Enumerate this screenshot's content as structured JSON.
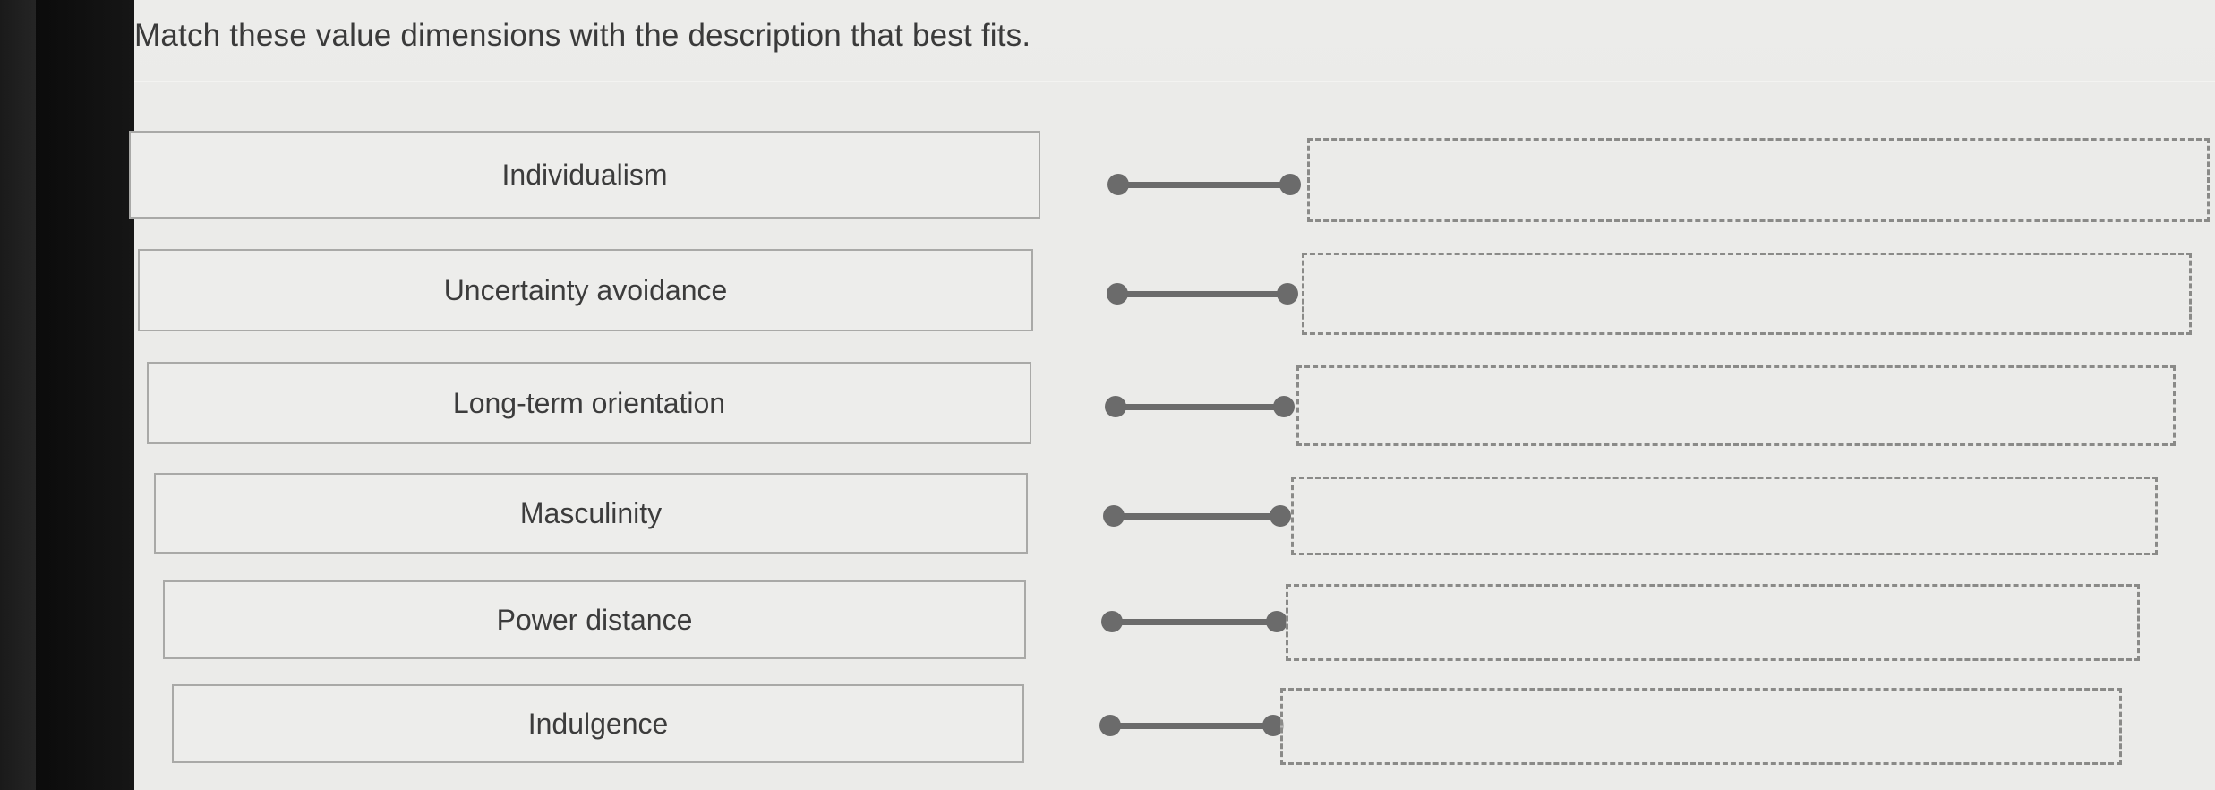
{
  "question": "Match these value dimensions with the description that best fits.",
  "terms": [
    {
      "label": "Individualism"
    },
    {
      "label": "Uncertainty avoidance"
    },
    {
      "label": "Long-term orientation"
    },
    {
      "label": "Masculinity"
    },
    {
      "label": "Power distance"
    },
    {
      "label": "Indulgence"
    }
  ],
  "drop_zones": [
    {
      "value": ""
    },
    {
      "value": ""
    },
    {
      "value": ""
    },
    {
      "value": ""
    },
    {
      "value": ""
    },
    {
      "value": ""
    }
  ],
  "colors": {
    "connector": "#6b6b6b",
    "box_border": "#a9a9a7",
    "dashed_border": "#8a8a88",
    "text": "#3c3c3c"
  }
}
